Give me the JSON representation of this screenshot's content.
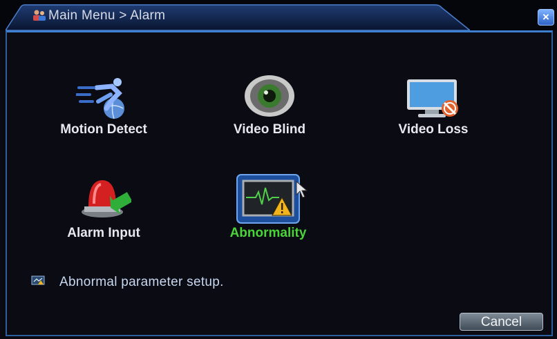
{
  "window": {
    "title": "Main Menu > Alarm",
    "close_label": "×"
  },
  "menu": {
    "items": [
      {
        "label": "Motion Detect",
        "icon": "running-man-globe-icon",
        "selected": false
      },
      {
        "label": "Video Blind",
        "icon": "eye-camera-icon",
        "selected": false
      },
      {
        "label": "Video Loss",
        "icon": "monitor-no-signal-icon",
        "selected": false
      },
      {
        "label": "Alarm Input",
        "icon": "red-siren-icon",
        "selected": false
      },
      {
        "label": "Abnormality",
        "icon": "monitor-warning-icon",
        "selected": true
      }
    ]
  },
  "hint": {
    "text": "Abnormal parameter setup."
  },
  "footer": {
    "cancel_label": "Cancel"
  },
  "colors": {
    "selected_label": "#4bd43a",
    "border": "#2c5f9d"
  }
}
